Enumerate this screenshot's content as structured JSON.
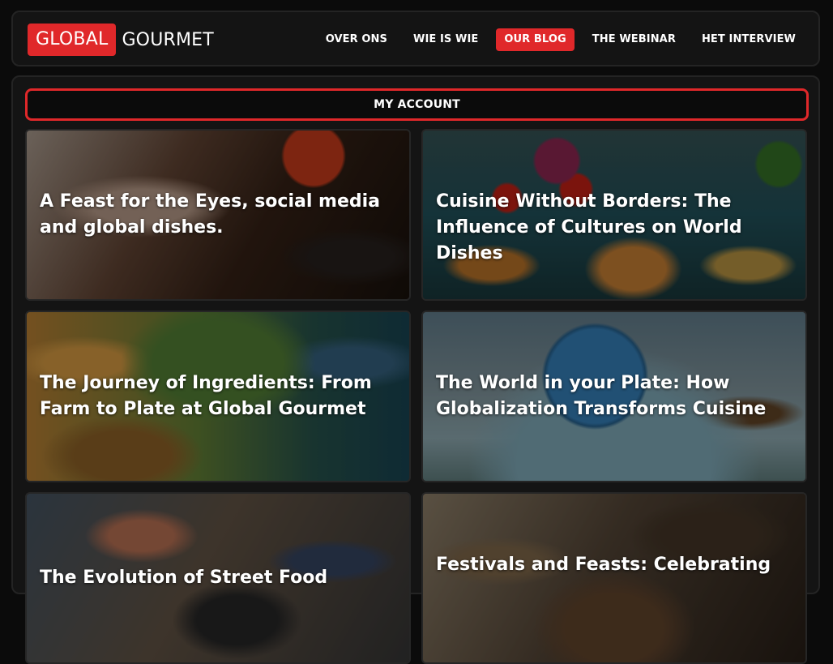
{
  "brand": {
    "part1": "GLOBAL",
    "part2": "GOURMET",
    "accent_color": "#e0282a"
  },
  "nav": {
    "items": [
      {
        "label": "OVER ONS",
        "active": false
      },
      {
        "label": "WIE IS WIE",
        "active": false
      },
      {
        "label": "OUR BLOG",
        "active": true
      },
      {
        "label": "THE WEBINAR",
        "active": false
      },
      {
        "label": "HET INTERVIEW",
        "active": false
      }
    ]
  },
  "account": {
    "label": "MY ACCOUNT"
  },
  "posts": [
    {
      "title": "A Feast for the Eyes, social media and global dishes."
    },
    {
      "title": "Cuisine Without Borders: The Influence of Cultures on World Dishes"
    },
    {
      "title": "The Journey of Ingredients: From Farm to Plate at Global Gourmet"
    },
    {
      "title": "The World in your Plate: How Globalization Transforms Cuisine"
    },
    {
      "title": "The Evolution of Street Food"
    },
    {
      "title": "Festivals and Feasts: Celebrating"
    }
  ]
}
